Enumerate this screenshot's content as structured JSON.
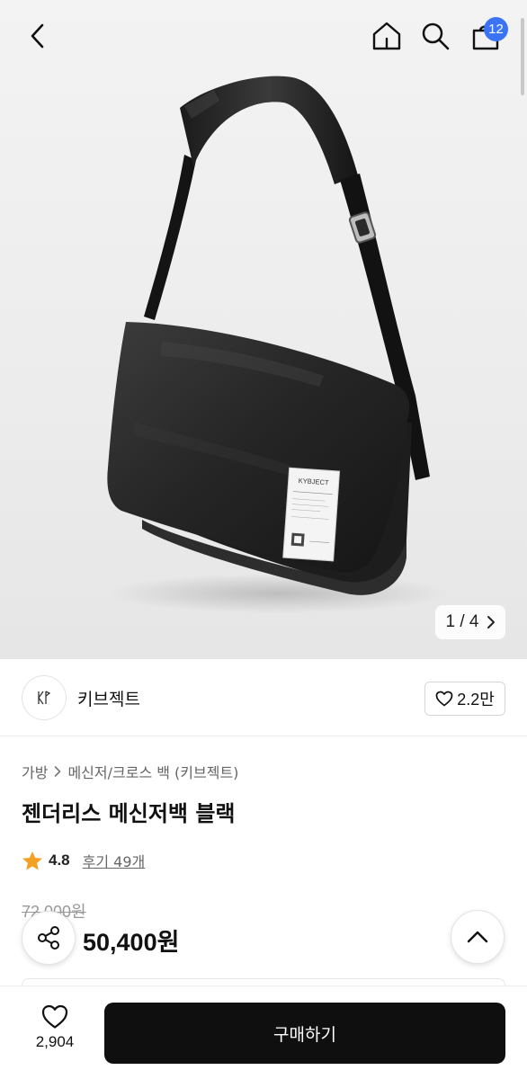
{
  "gallery": {
    "pager_current": "1",
    "pager_separator": "/",
    "pager_total": "4",
    "label_text": "KYBJECT"
  },
  "header": {
    "cart_count": "12"
  },
  "brand": {
    "name": "키브젝트",
    "likes": "2.2만"
  },
  "product": {
    "breadcrumb": [
      "가방",
      "메신저/크로스 백 (키브젝트)"
    ],
    "title": "젠더리스 메신저백 블랙",
    "rating": "4.8",
    "reviews": "후기 49개",
    "original_price": "72,000원",
    "price": "50,400원"
  },
  "bottom_bar": {
    "wish_count": "2,904",
    "buy_label": "구매하기"
  },
  "colors": {
    "badge": "#3b73f5",
    "star": "#f3a125",
    "buy_button": "#0f0f0f"
  },
  "icons": [
    "back-icon",
    "home-icon",
    "search-icon",
    "cart-icon",
    "chevron-right-icon",
    "heart-icon",
    "star-icon",
    "share-icon",
    "chevron-up-icon"
  ]
}
